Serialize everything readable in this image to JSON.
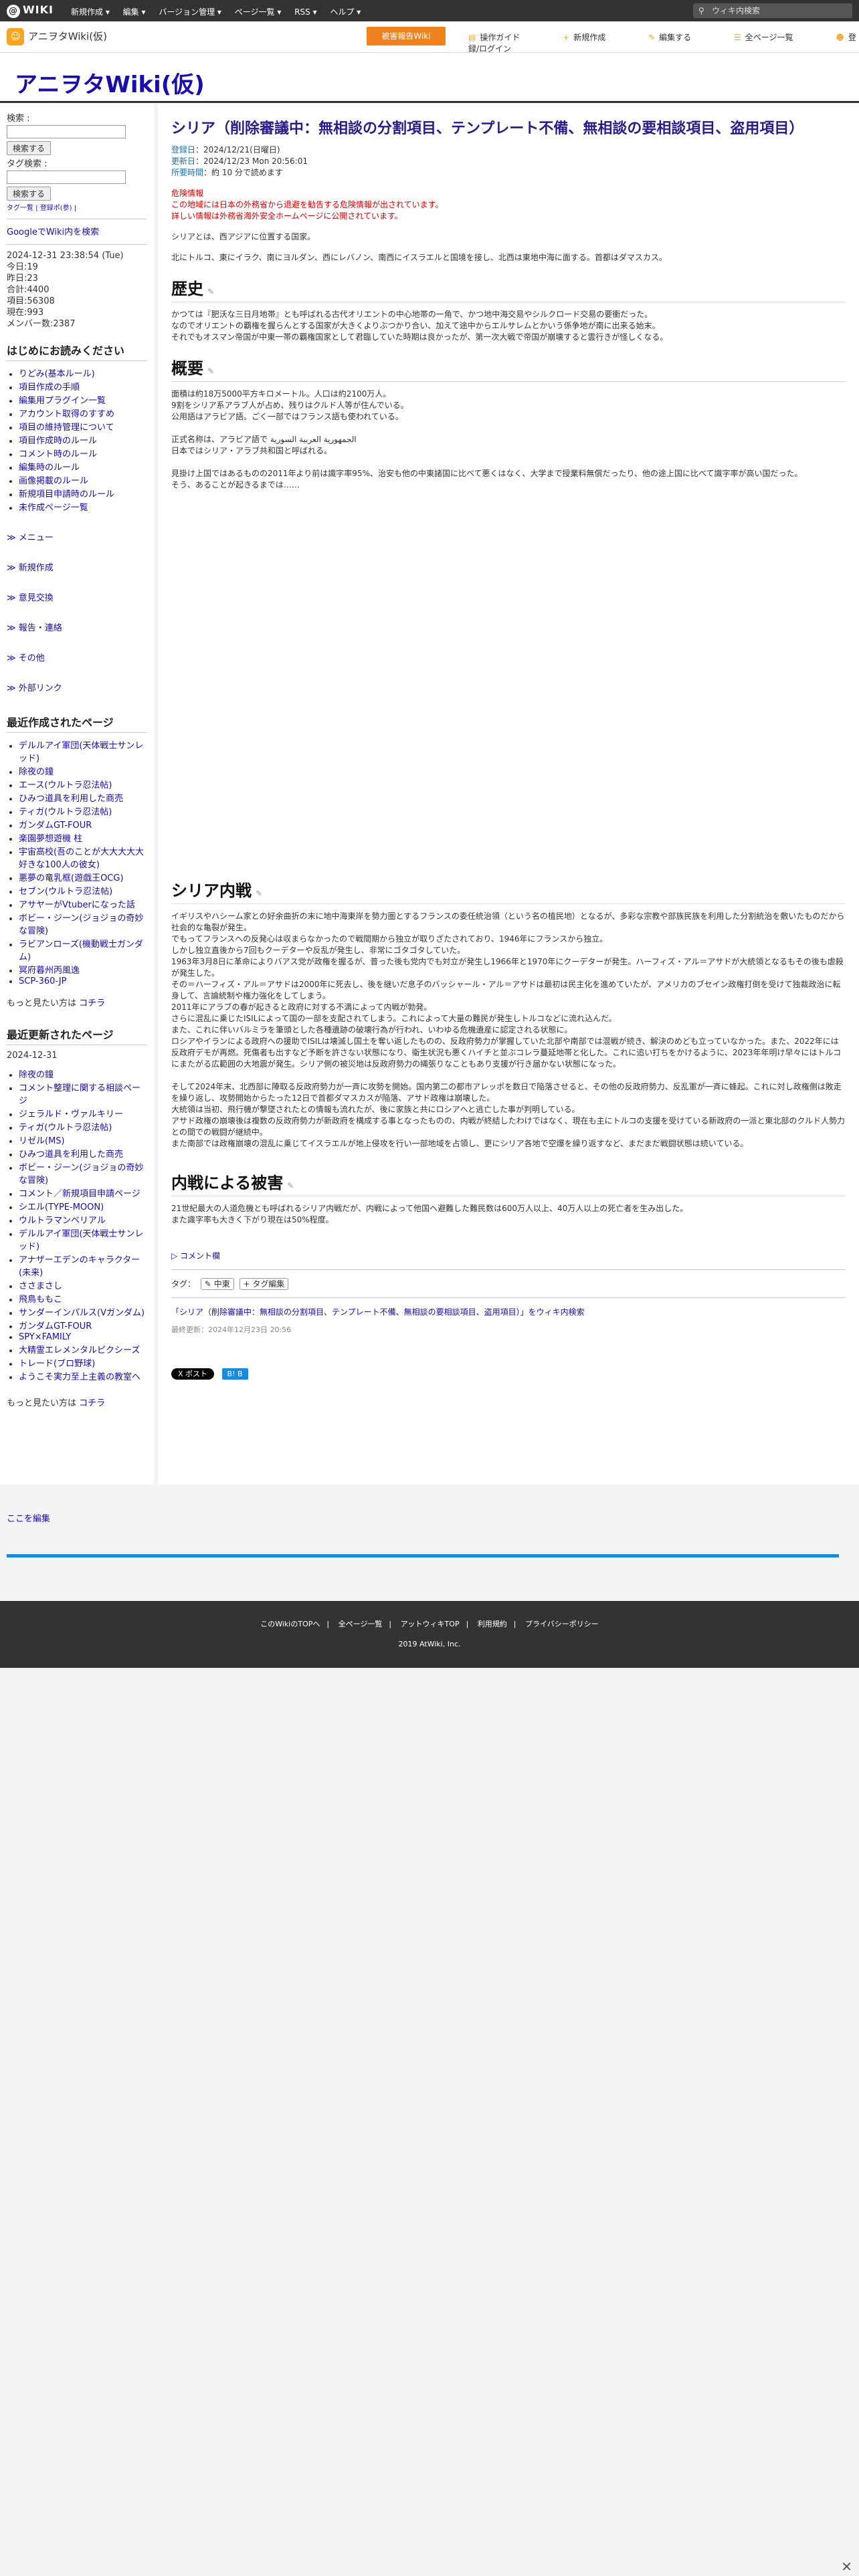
{
  "topbar": {
    "logo": "WIKI",
    "menu": [
      "新規作成 ▾",
      "編集 ▾",
      "バージョン管理 ▾",
      "ページ一覧 ▾",
      "RSS ▾",
      "ヘルプ ▾"
    ],
    "search_placeholder": "ウィキ内検索"
  },
  "toolbar": {
    "site_name": "アニヲタWiki(仮)",
    "cta": "被害報告Wiki",
    "tools": [
      "操作ガイド",
      "新規作成",
      "編集する",
      "全ページ一覧",
      "登録/ログイン"
    ]
  },
  "header": {
    "title": "アニヲタWiki(仮)"
  },
  "sidebar": {
    "search_label": "検索 :",
    "search_button": "検索する",
    "tag_label": "タグ検索 :",
    "tag_button": "検索する",
    "tag_small": "タグ一覧 | 登録ポ(参) |",
    "google": "GoogleでWiki内を検索",
    "stats": [
      "2024-12-31 23:38:54 (Tue)",
      "今日:19",
      "昨日:23",
      "合計:4400",
      "項目:56308",
      "現在:993",
      "メンバー数:2387"
    ],
    "first_read_title": "はじめにお読みください",
    "first_read": [
      "りどみ(基本ルール)",
      "項目作成の手順",
      "編集用プラグイン一覧",
      "アカウント取得のすすめ",
      "項目の維持管理について",
      "項目作成時のルール",
      "コメント時のルール",
      "編集時のルール",
      "画像掲載のルール",
      "新規項目申請時のルール",
      "未作成ページ一覧"
    ],
    "nav": [
      "≫ メニュー",
      "≫ 新規作成",
      "≫ 意見交換",
      "≫ 報告・連絡",
      "≫ その他",
      "≫ 外部リンク"
    ],
    "recent_created_title": "最近作成されたページ",
    "recent_created": [
      "デルルアイ軍団(天体戦士サンレッド)",
      "除夜の鐘",
      "エース(ウルトラ忍法帖)",
      "ひみつ道具を利用した商売",
      "ティガ(ウルトラ忍法帖)",
      "ガンダムGT-FOUR",
      "楽園夢想遊機 柱",
      "宇宙高校(吾のことが大大大大大好きな100人の彼女)",
      "悪夢の竜乳框(遊戯王OCG)",
      "セブン(ウルトラ忍法帖)",
      "アサヤーがVtuberになった話",
      "ボビー・ジーン(ジョジョの奇妙な冒険)",
      "ラビアンローズ(機動戦士ガンダム)",
      "冥府暮州丙風逸",
      "SCP-360-JP"
    ],
    "more_label": "もっと見たい方は",
    "more_link": "コチラ",
    "recent_updated_title": "最近更新されたページ",
    "recent_updated_date": "2024-12-31",
    "recent_updated": [
      "除夜の鐘",
      "コメント整理に関する相談ページ",
      "ジェラルド・ヴァルキリー",
      "ティガ(ウルトラ忍法帖)",
      "リゼル(MS)",
      "ひみつ道具を利用した商売",
      "ボビー・ジーン(ジョジョの奇妙な冒険)",
      "コメント／新規項目申請ページ",
      "シエル(TYPE-MOON)",
      "ウルトラマンベリアル",
      "デルルアイ軍団(天体戦士サンレッド)",
      "アナザーエデンのキャラクター(未来)",
      "ささまさし",
      "飛鳥ももこ",
      "サンダーインパルス(Vガンダム)",
      "ガンダムGT-FOUR",
      "SPY×FAMILY",
      "大精霊エレメンタルピクシーズ",
      "トレード(ブロ野球)",
      "ようこそ実力至上主義の教室へ"
    ],
    "more_label2": "もっと見たい方は",
    "more_link2": "コチラ",
    "edit_here": "ここを編集"
  },
  "content": {
    "title": "シリア（削除審議中：無相談の分割項目、テンプレート不備、無相談の要相談項目、盗用項目）",
    "meta": [
      {
        "k": "登録日",
        "v": "：2024/12/21(日曜日)"
      },
      {
        "k": "更新日",
        "v": "：2024/12/23 Mon 20:56:01"
      },
      {
        "k": "所要時間",
        "v": "：約 10 分で読めます"
      }
    ],
    "warn_head": "危険情報",
    "warn_lines": [
      "この地域には日本の外務省から退避を勧告する危険情報が出されています。",
      "詳しい情報は外務省海外安全ホームページに公開されています。"
    ],
    "intro": [
      "シリアとは、西アジアに位置する国家。",
      "北にトルコ、東にイラク、南にヨルダン、西にレバノン、南西にイスラエルと国境を接し、北西は東地中海に面する。首都はダマスカス。"
    ],
    "history_title": "歴史",
    "history": [
      "かつては『肥沃な三日月地帯』とも呼ばれる古代オリエントの中心地帯の一角で、かつ地中海交易やシルクロード交易の要衝だった。",
      "なのでオリエントの覇権を握らんとする国家が大きくよりぶつかり合い、加えて途中からエルサレムとかいう係争地が南に出来る始末。",
      "それでもオスマン帝国が中東一帯の覇権国家として君臨していた時期は良かったが、第一次大戦で帝国が崩壊すると雲行きが怪しくなる。"
    ],
    "overview_title": "概要",
    "overview": [
      "面積は約18万5000平方キロメートル。人口は約2100万人。",
      "9割をシリア系アラブ人が占め、残りはクルド人等が住んでいる。",
      "公用語はアラビア語。ごく一部ではフランス語も使われている。",
      "",
      "正式名称は、アラビア語で الجمهورية العربية السورية",
      "日本ではシリア・アラブ共和国と呼ばれる。",
      "",
      "見掛け上国ではあるものの2011年より前は識字率95%、治安も他の中東諸国に比べて悪くはなく、大学まで授業料無償だったり、他の途上国に比べて識字率が高い国だった。",
      "そう、あることが起きるまでは……"
    ],
    "war_title": "シリア内戦",
    "war": [
      "イギリスやハシーム家との好余曲折の末に地中海東岸を勢力圏とするフランスの委任統治領（という名の植民地）となるが、多彩な宗教や部族民族を利用した分割統治を敷いたものだから社会的な亀裂が発生。",
      "でもってフランスへの反発心は収まらなかったので戦間期から独立が取りざたされており、1946年にフランスから独立。",
      "しかし独立直後から7回もクーデターや反乱が発生し、非常にゴタゴタしていた。",
      "1963年3月8日に革命によりバアス党が政権を握るが、普った後も党内でも対立が発生し1966年と1970年にクーデターが発生。ハーフィズ・アル＝アサドが大統領となるもその後も虐殺が発生した。",
      "その＝ハーフィズ・アル＝アサドは2000年に死去し、後を継いだ息子のバッシャール・アル＝アサドは最初は民主化を進めていたが、アメリカのブセイン政権打倒を受けて独裁政治に転身して、言論統制や権力強化をしてしまう。",
      "2011年にアラブの春が起きると政府に対する不満によって内戦が勃発。",
      "さらに混乱に乗じたISILによって国の一部を支配されてしまう。これによって大量の難民が発生しトルコなどに流れ込んだ。",
      "また、これに伴いバルミラを筆頭とした各種遺跡の破壊行為が行われ、いわゆる危機遺産に認定される状態に。",
      "ロシアやイランによる政府への援助でISILは壊滅し国土を奪い返したものの、反政府勢力が掌握していた北部や南部では混戦が続き、解決のめども立っていなかった。また、2022年には反政府デモが再燃。死傷者も出すなど予断を許さない状態になり、衛生状況も悪くハイチと並ぶコレラ蔓延地帯と化した。これに追い打ちをかけるように、2023年年明け早々にはトルコにまたがる広範囲の大地震が発生。シリア側の被災地は反政府勢力の縄張りなこともあり支援が行き届かない状態になった。",
      "",
      "そして2024年末、北西部に陣取る反政府勢力が一斉に攻勢を開始。国内第二の都市アレッポを数日で陥落させると、その他の反政府勢力、反乱軍が一斉に蜂起。これに対し政権側は敗走を繰り返し、攻勢開始からたった12日で首都ダマスカスが陥落、アサド政権は崩壊した。",
      "大統領は当初、飛行機が撃墜されたとの情報も流れたが、後に家族と共にロシアへと逃亡した事が判明している。",
      "アサド政権の崩壊後は複数の反政府勢力が新政府を構成する事となったものの、内戦が終結したわけではなく、現在も主にトルコの支援を受けている新政府の一派と東北部のクルド人勢力との間での戦闘が継続中。",
      "また南部では政権崩壊の混乱に乗じてイスラエルが地上侵攻を行い一部地域を占領し、更にシリア各地で空爆を繰り返すなど、まだまだ戦闘状態は続いている。"
    ],
    "damage_title": "内戦による被害",
    "damage": [
      "21世紀最大の人道危機とも呼ばれるシリア内戦だが、内戦によって他国へ避難した難民数は600万人以上、40万人以上の死亡者を生み出した。",
      "また識字率も大きく下がり現在は50%程度。"
    ],
    "comment_toggle": "▷ コメント欄",
    "tag_label": "タグ：",
    "tags": [
      "✎ 中東",
      "+ タグ編集"
    ],
    "search_link": "「シリア（削除審議中：無相談の分割項目、テンプレート不備、無相談の要相談項目、盗用項目）」をウィキ内検索",
    "last_updated": "最終更新：2024年12月23日 20:56",
    "share": [
      "X ポスト",
      "B! B"
    ]
  },
  "footer": {
    "links": [
      "このWikiのTOPへ",
      "全ページ一覧",
      "アットウィキTOP",
      "利用規約",
      "プライバシーポリシー"
    ],
    "copy": "2019 AtWiki, Inc."
  },
  "close": "✕"
}
